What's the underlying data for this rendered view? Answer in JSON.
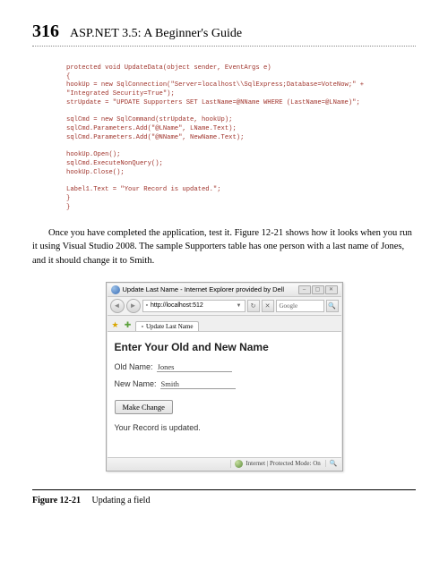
{
  "header": {
    "page_number": "316",
    "book_title": "ASP.NET 3.5: A Beginner's Guide"
  },
  "code": "protected void UpdateData(object sender, EventArgs e)\n{\nhookUp = new SqlConnection(\"Server=localhost\\\\SqlExpress;Database=VoteNow;\" +\n\"Integrated Security=True\");\nstrUpdate = \"UPDATE Supporters SET LastName=@NName WHERE (LastName=@LName)\";\n\nsqlCmd = new SqlCommand(strUpdate, hookUp);\nsqlCmd.Parameters.Add(\"@LName\", LName.Text);\nsqlCmd.Parameters.Add(\"@NName\", NewName.Text);\n\nhookUp.Open();\nsqlCmd.ExecuteNonQuery();\nhookUp.Close();\n\nLabel1.Text = \"Your Record is updated.\";\n}\n}",
  "paragraph": "Once you have completed the application, test it. Figure 12-21 shows how it looks when you run it using Visual Studio 2008. The sample Supporters table has one person with a last name of Jones, and it should change it to Smith.",
  "browser": {
    "window_title": "Update Last Name - Internet Explorer provided by Dell",
    "url": "http://localhost:512",
    "search_placeholder": "Google",
    "tab_title": "Update Last Name"
  },
  "form": {
    "heading": "Enter Your Old and New Name",
    "old_label": "Old Name:",
    "old_value": "Jones",
    "new_label": "New Name:",
    "new_value": "Smith",
    "button": "Make Change",
    "result": "Your Record is updated."
  },
  "status": {
    "text": "Internet | Protected Mode: On"
  },
  "figure": {
    "label": "Figure 12-21",
    "caption": "Updating a field"
  }
}
